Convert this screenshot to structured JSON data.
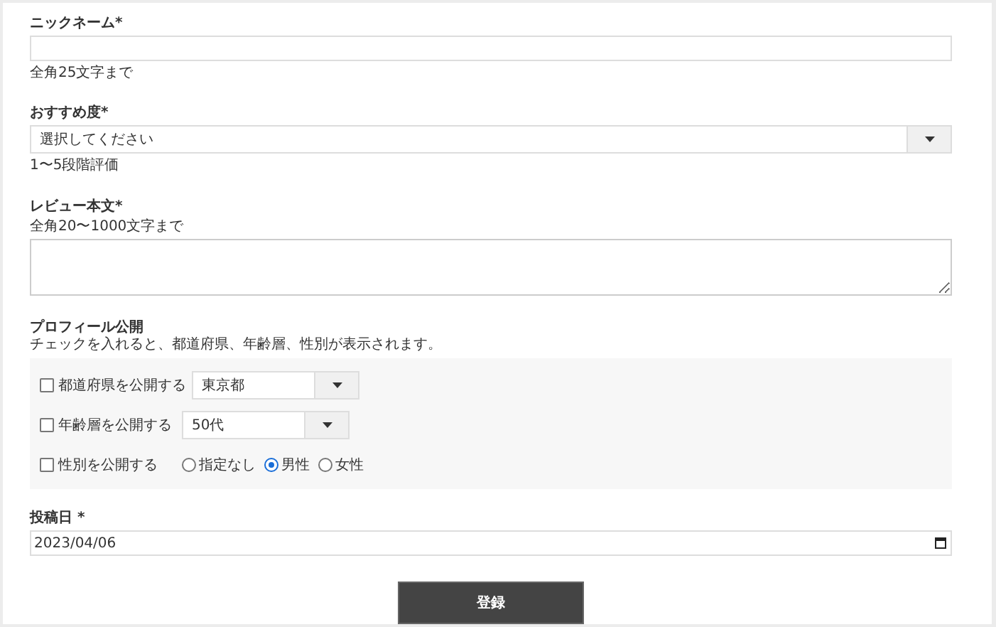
{
  "nickname": {
    "label": "ニックネーム",
    "required": "*",
    "hint": "全角25文字まで"
  },
  "rating": {
    "label": "おすすめ度",
    "required": "*",
    "placeholder": "選択してください",
    "hint": "1〜5段階評価"
  },
  "review": {
    "label": "レビュー本文",
    "required": "*",
    "hint": "全角20〜1000文字まで"
  },
  "profile": {
    "title": "プロフィール公開",
    "description": "チェックを入れると、都道府県、年齢層、性別が表示されます。",
    "rows": [
      {
        "kind": "select",
        "label": "都道府県を公開する",
        "checked": false,
        "value": "東京都"
      },
      {
        "kind": "select",
        "label": "年齢層を公開する",
        "checked": false,
        "value": "50代"
      },
      {
        "kind": "radio",
        "label": "性別を公開する",
        "checked": false,
        "options": [
          {
            "label": "指定なし",
            "selected": false
          },
          {
            "label": "男性",
            "selected": true
          },
          {
            "label": "女性",
            "selected": false
          }
        ]
      }
    ]
  },
  "post_date": {
    "label": "投稿日",
    "required": "*",
    "value": "2023/04/06"
  },
  "submit": {
    "label": "登録"
  }
}
